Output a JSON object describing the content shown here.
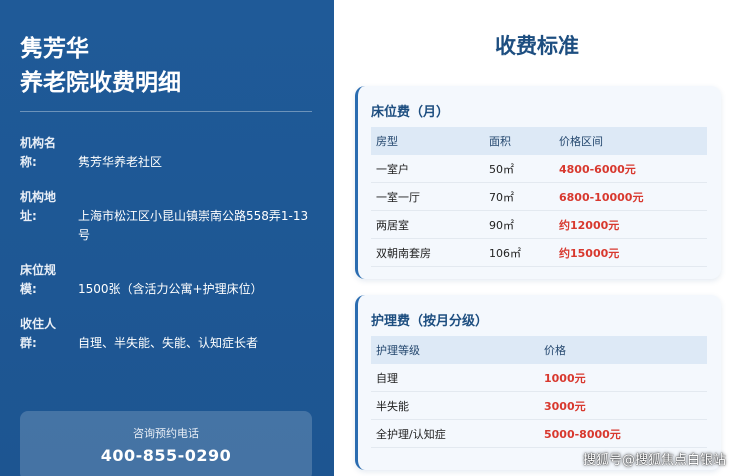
{
  "left": {
    "title_line1": "隽芳华",
    "title_line2": "养老院收费明细",
    "info": [
      {
        "label1": "机构名",
        "label2": "称:",
        "value1": "",
        "value2": "隽芳华养老社区",
        "value3": ""
      },
      {
        "label1": "机构地",
        "label2": "址:",
        "value1": "",
        "value2": "上海市松江区小昆山镇崇南公路558弄1-13",
        "value3": "号"
      },
      {
        "label1": "床位规",
        "label2": "模:",
        "value1": "",
        "value2": "1500张（含活力公寓+护理床位）",
        "value3": ""
      },
      {
        "label1": "收住人",
        "label2": "群:",
        "value1": "",
        "value2": "自理、半失能、失能、认知症长者",
        "value3": ""
      }
    ],
    "phone_caption": "咨询预约电话",
    "phone_number": "400-855-0290"
  },
  "right": {
    "page_title": "收费标准",
    "bed_fee": {
      "title": "床位费（月）",
      "headers": [
        "房型",
        "面积",
        "价格区间"
      ],
      "rows": [
        [
          "一室户",
          "50㎡",
          "4800-6000元"
        ],
        [
          "一室一厅",
          "70㎡",
          "6800-10000元"
        ],
        [
          "两居室",
          "90㎡",
          "约12000元"
        ],
        [
          "双朝南套房",
          "106㎡",
          "约15000元"
        ]
      ]
    },
    "care_fee": {
      "title": "护理费（按月分级）",
      "headers": [
        "护理等级",
        "价格"
      ],
      "rows": [
        [
          "自理",
          "1000元"
        ],
        [
          "半失能",
          "3000元"
        ],
        [
          "全护理/认知症",
          "5000-8000元"
        ]
      ]
    }
  },
  "watermark": "搜狐号@搜狐焦点白银站",
  "colors": {
    "left_panel": "#1f5a98",
    "title_blue": "#1d4e80",
    "price_red": "#d8382e",
    "table_header": "#dde9f6"
  }
}
